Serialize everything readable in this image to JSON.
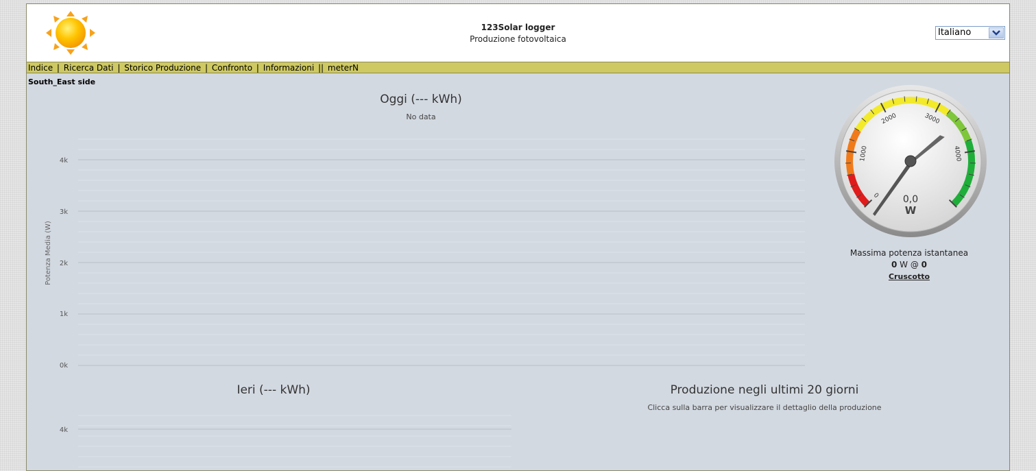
{
  "header": {
    "app_title": "123Solar logger",
    "app_subtitle": "Produzione fotovoltaica",
    "language_selected": "Italiano"
  },
  "nav": {
    "items": [
      {
        "label": "Indice"
      },
      {
        "label": "Ricerca Dati"
      },
      {
        "label": "Storico Produzione"
      },
      {
        "label": "Confronto"
      },
      {
        "label": "Informazioni"
      },
      {
        "label": "meterN"
      }
    ],
    "separators": [
      "|",
      "|",
      "|",
      "|",
      "||"
    ]
  },
  "site_name": "South_East side",
  "today_chart": {
    "title": "Oggi (--- kWh)",
    "subtitle": "No data",
    "ylabel": "Potenza Media (W)",
    "yticks": [
      "4k",
      "3k",
      "2k",
      "1k",
      "0k"
    ]
  },
  "gauge": {
    "value_text": "0,0",
    "unit": "W",
    "scale_labels": [
      "0",
      "1000",
      "2000",
      "3000",
      "4000"
    ],
    "caption": "Massima potenza istantanea",
    "max_value": "0",
    "max_unit": "W @",
    "max_time": "0",
    "link": "Cruscotto"
  },
  "yesterday_chart": {
    "title": "Ieri (--- kWh)",
    "yticks": [
      "4k"
    ]
  },
  "last20_chart": {
    "title": "Produzione negli ultimi 20 giorni",
    "subtitle": "Clicca sulla barra per visualizzare il dettaglio della produzione"
  },
  "chart_data": [
    {
      "type": "line",
      "title": "Oggi (--- kWh)",
      "subtitle": "No data",
      "ylabel": "Potenza Media (W)",
      "ylim": [
        0,
        4000
      ],
      "yticks": [
        "0k",
        "1k",
        "2k",
        "3k",
        "4k"
      ],
      "series": []
    },
    {
      "type": "line",
      "title": "Ieri (--- kWh)",
      "ylabel": "",
      "yticks": [
        "4k"
      ],
      "series": []
    },
    {
      "type": "bar",
      "title": "Produzione negli ultimi 20 giorni",
      "subtitle": "Clicca sulla barra per visualizzare il dettaglio della produzione",
      "series": []
    }
  ]
}
